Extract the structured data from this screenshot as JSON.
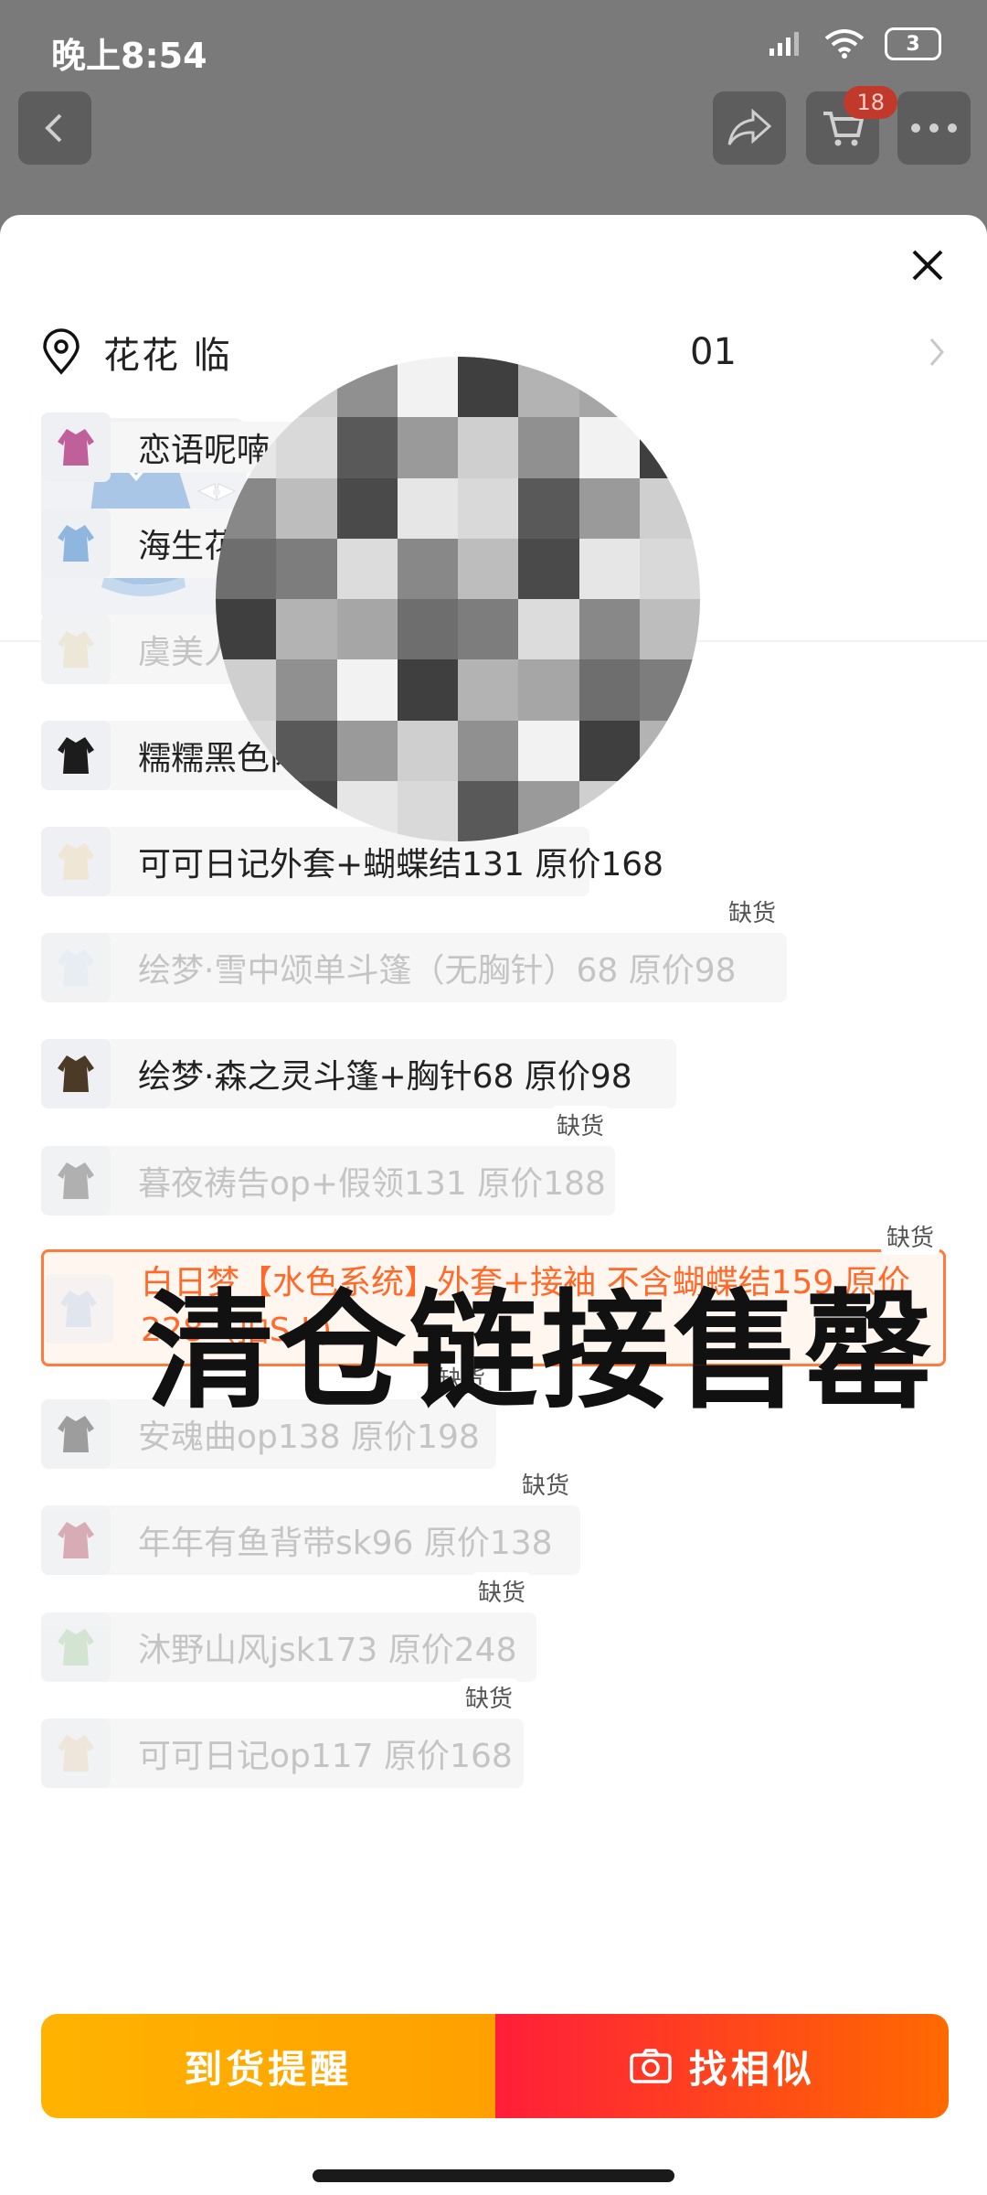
{
  "status_bar": {
    "time": "晚上8:54",
    "battery": "3"
  },
  "top_nav": {
    "cart_count": "18"
  },
  "address": {
    "name": "花花",
    "partial": "临",
    "tail": "01"
  },
  "stepper": {
    "minus": "-",
    "suffix": "货"
  },
  "options": [
    {
      "label": "恋语呢喃op117 原价168",
      "out_of_stock": false
    },
    {
      "label": "海生花op+蝴蝶结198 原价248",
      "out_of_stock": false
    },
    {
      "label": "虞美人op173 原价248",
      "out_of_stock": true,
      "tag": "缺货"
    },
    {
      "label": "糯糯黑色内搭78 原价98",
      "out_of_stock": false
    },
    {
      "label": "可可日记外套+蝴蝶结131 原价168",
      "out_of_stock": false
    },
    {
      "label": "绘梦·雪中颂单斗篷（无胸针）68 原价98",
      "out_of_stock": true,
      "tag": "缺货"
    },
    {
      "label": "绘梦·森之灵斗篷+胸针68 原价98",
      "out_of_stock": false
    },
    {
      "label": "暮夜祷告op+假领131 原价188",
      "out_of_stock": true,
      "tag": "缺货"
    },
    {
      "label": "白日梦【水色系统】外套+接袖  不含蝴蝶结159 原价228（拍S L)",
      "out_of_stock": true,
      "tag": "缺货",
      "selected": true
    },
    {
      "label": "安魂曲op138 原价198",
      "out_of_stock": true,
      "tag": "缺货"
    },
    {
      "label": "年年有鱼背带sk96 原价138",
      "out_of_stock": true,
      "tag": "缺货"
    },
    {
      "label": "沐野山风jsk173 原价248",
      "out_of_stock": true,
      "tag": "缺货"
    },
    {
      "label": "可可日记op117 原价168",
      "out_of_stock": true,
      "tag": "缺货"
    }
  ],
  "watermark": "清仓链接售罄",
  "buttons": {
    "notify": "到货提醒",
    "similar": "找相似"
  },
  "colors": {
    "accent_orange": "#ff6a2a",
    "notify_yellow": "#ffa000",
    "similar_red": "#ff1e3a"
  }
}
